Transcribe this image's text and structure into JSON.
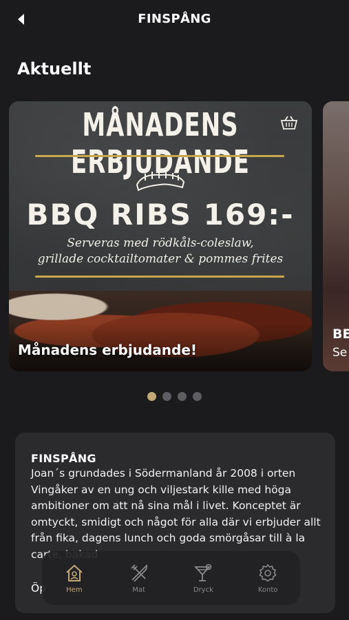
{
  "header": {
    "title": "FINSPÅNG"
  },
  "section": {
    "title": "Aktuellt"
  },
  "carousel": {
    "cards": [
      {
        "chalk_title": "MÅNADENS ERBJUDANDE",
        "price_line": "BBQ RIBS 169:-",
        "desc_line1": "Serveras med rödkåls-coleslaw,",
        "desc_line2": "grillade cocktailtomater & pommes frites",
        "caption": "Månadens erbjudande!"
      },
      {
        "title": "BE",
        "subtitle": "Se"
      }
    ],
    "active_index": 0,
    "dot_count": 4
  },
  "info": {
    "heading": "FINSPÅNG",
    "body": "Joan´s grundades i Södermanland år 2008 i orten Vingåker av en ung och viljestark kille med höga ambitioner om att nå sina mål i livet. Konceptet är omtyckt, smidigt och något för alla där vi erbjuder allt från fika, dagens lunch och goda smörgåsar till à la carte, bakad",
    "hours": "Öp"
  },
  "nav": {
    "items": [
      {
        "label": "Hem",
        "icon": "home-icon",
        "active": true
      },
      {
        "label": "Mat",
        "icon": "fork-knife-icon",
        "active": false
      },
      {
        "label": "Dryck",
        "icon": "cocktail-icon",
        "active": false
      },
      {
        "label": "Konto",
        "icon": "gear-icon",
        "active": false
      }
    ]
  },
  "colors": {
    "background": "#1b1b1d",
    "card": "#2b2b2e",
    "accent": "#c2a877",
    "inactive": "#8a8a8a"
  }
}
